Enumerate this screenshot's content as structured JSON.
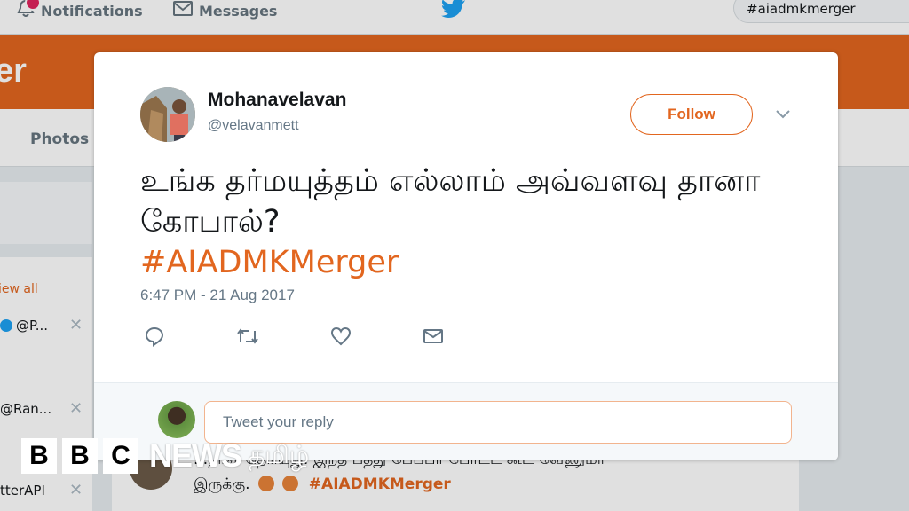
{
  "background": {
    "nav": {
      "notifications_label": "Notifications",
      "messages_label": "Messages",
      "search_value": "#aiadmkmerger"
    },
    "banner_text": "er",
    "profile_tab": "Photos",
    "sidebar": {
      "view_all": "iew all",
      "rows": [
        "@P...",
        "@Ran...",
        "tterAPI"
      ]
    },
    "bg_tweet": {
      "line1": "...தான் தெரியுது. இந்த பத்து பேப்பர் போட்ட் கூட வேணுமா",
      "line2": "இருக்கு.",
      "hashtag": "#AIADMKMerger"
    }
  },
  "tweet": {
    "display_name": "Mohanavelavan",
    "handle": "@velavanmett",
    "follow_label": "Follow",
    "text": "உங்க தர்மயுத்தம் எல்லாம் அவ்வளவு தானா கோபால்?",
    "hashtag": "#AIADMKMerger",
    "timestamp": "6:47 PM - 21 Aug 2017",
    "reply_placeholder": "Tweet your reply"
  },
  "brand": {
    "letters": [
      "B",
      "B",
      "C"
    ],
    "news": "NEWS",
    "language": "தமிழ்"
  },
  "colors": {
    "accent": "#e2661f",
    "text": "#14171a",
    "muted": "#657786"
  },
  "icons": [
    "bell-icon",
    "envelope-icon",
    "twitter-bird-icon",
    "chevron-down-icon",
    "reply-icon",
    "retweet-icon",
    "heart-icon",
    "direct-message-icon"
  ]
}
